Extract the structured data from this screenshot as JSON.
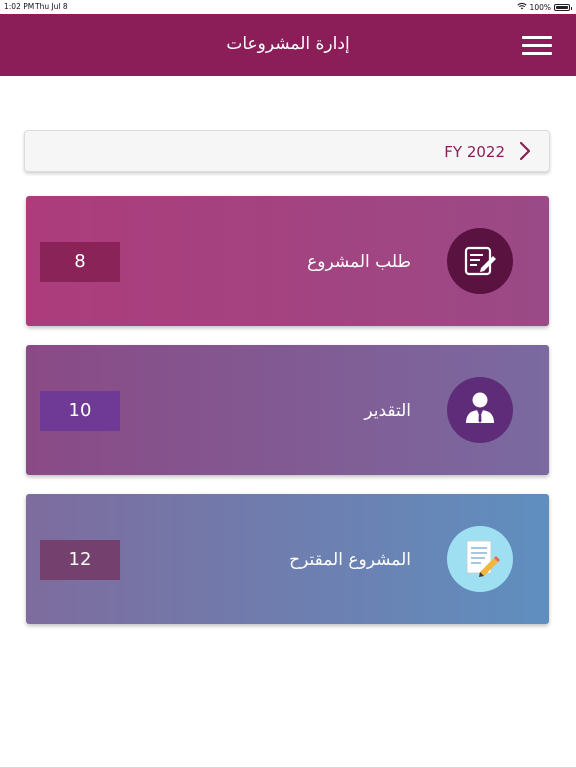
{
  "status_bar": {
    "time": "1:02 PM",
    "date": "Thu Jul 8",
    "battery": "100%",
    "battery_level": 1.0
  },
  "header": {
    "title": "إدارة المشروعات",
    "menu_icon": "hamburger-menu-icon",
    "background_color": "#8b1d58"
  },
  "fiscal_year": {
    "label": "FY 2022",
    "icon": "chevron-right-icon",
    "accent_color": "#8b1d58"
  },
  "cards": [
    {
      "label": "طلب المشروع",
      "count": "8",
      "icon": "edit-document-icon"
    },
    {
      "label": "التقدير",
      "count": "10",
      "icon": "user-icon"
    },
    {
      "label": "المشروع المقترح",
      "count": "12",
      "icon": "notepad-pencil-icon"
    }
  ]
}
